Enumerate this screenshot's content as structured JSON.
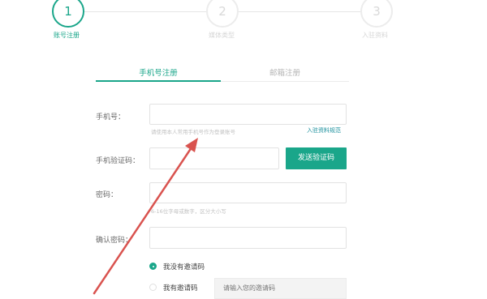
{
  "stepper": {
    "steps": [
      {
        "number": "1",
        "label": "账号注册",
        "active": true
      },
      {
        "number": "2",
        "label": "媒体类型",
        "active": false
      },
      {
        "number": "3",
        "label": "入驻资料",
        "active": false
      }
    ]
  },
  "tabs": [
    {
      "label": "手机号注册",
      "active": true
    },
    {
      "label": "邮箱注册",
      "active": false
    }
  ],
  "form": {
    "phone": {
      "label": "手机号：",
      "value": "",
      "hint": "请使用本人常用手机号作为登录账号",
      "link": "入驻资料规范"
    },
    "verify": {
      "label": "手机验证码：",
      "value": "",
      "button": "发送验证码"
    },
    "password": {
      "label": "密码：",
      "value": "",
      "hint": "6-16位字母或数字，区分大小写"
    },
    "confirm": {
      "label": "确认密码：",
      "value": ""
    },
    "invite": {
      "no_code_label": "我没有邀请码",
      "has_code_label": "我有邀请码",
      "selected": "no_code",
      "placeholder": "请输入您的邀请码"
    }
  },
  "colors": {
    "accent": "#1aa68a",
    "annotation_arrow": "#d9534f"
  }
}
